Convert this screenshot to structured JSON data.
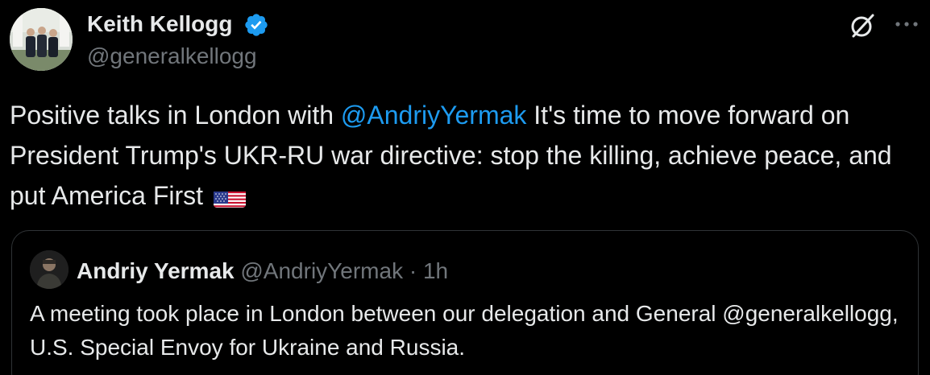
{
  "author": {
    "display_name": "Keith Kellogg",
    "handle": "@generalkellogg",
    "verified_icon": "verified-badge-icon",
    "avatar_icon": "profile-photo"
  },
  "actions": {
    "grok_icon": "grok-icon",
    "more_icon": "more-options-icon"
  },
  "tweet": {
    "text_before": "Positive talks in London with ",
    "mention": "@AndriyYermak",
    "text_after": " It's time to move forward on President Trump's UKR-RU war directive: stop the killing, achieve peace, and put America First",
    "emoji": "us-flag-emoji"
  },
  "quote": {
    "display_name": "Andriy Yermak",
    "handle": "@AndriyYermak",
    "separator": "·",
    "time": "1h",
    "text": "A meeting took place in London between our delegation and General @generalkellogg, U.S. Special Envoy for Ukraine and Russia."
  },
  "colors": {
    "background": "#000000",
    "text": "#e7e9ea",
    "secondary": "#71767b",
    "accent": "#1d9bf0",
    "border": "#2f3336"
  }
}
